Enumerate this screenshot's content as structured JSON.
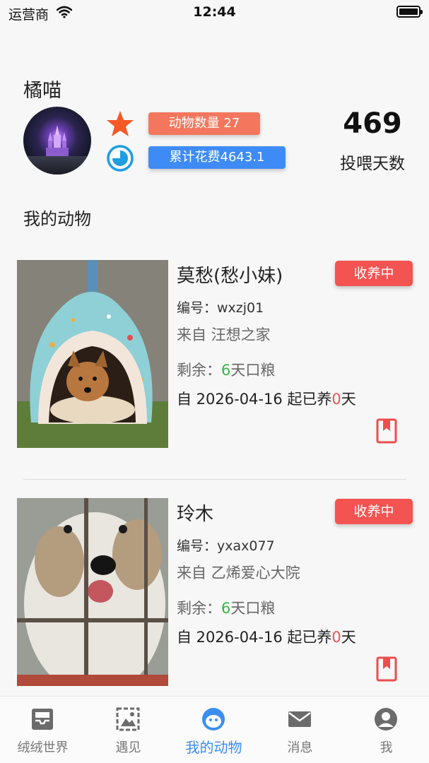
{
  "status_bar": {
    "carrier": "运营商",
    "time": "12:44"
  },
  "profile": {
    "name": "橘喵",
    "animal_count_label": "动物数量 27",
    "total_spend_label": "累计花费4643.1",
    "feed_days_value": "469",
    "feed_days_label": "投喂天数"
  },
  "section_title": "我的动物",
  "animals": [
    {
      "name": "莫愁(愁小妹)",
      "status": "收养中",
      "id_text": "编号：wxzj01",
      "from_text": "来自 汪想之家",
      "food_prefix": "剩余：",
      "food_days": "6",
      "food_suffix": "天口粮",
      "since_prefix": "自 2026-04-16 起已养",
      "since_days": "0",
      "since_suffix": "天"
    },
    {
      "name": "玲木",
      "status": "收养中",
      "id_text": "编号：yxax077",
      "from_text": "来自 乙烯爱心大院",
      "food_prefix": "剩余：",
      "food_days": "6",
      "food_suffix": "天口粮",
      "since_prefix": "自 2026-04-16 起已养",
      "since_days": "0",
      "since_suffix": "天"
    }
  ],
  "tabs": [
    {
      "label": "绒绒世界",
      "icon": "inbox-icon"
    },
    {
      "label": "遇见",
      "icon": "picture-icon"
    },
    {
      "label": "我的动物",
      "icon": "pet-face-icon",
      "active": true
    },
    {
      "label": "消息",
      "icon": "mail-icon"
    },
    {
      "label": "我",
      "icon": "user-icon"
    }
  ],
  "colors": {
    "count_badge": "#f4765d",
    "spend_badge": "#3e8bf5",
    "status_badge": "#f35351",
    "accent": "#3a8ef0",
    "food_green": "#3bb34a"
  }
}
